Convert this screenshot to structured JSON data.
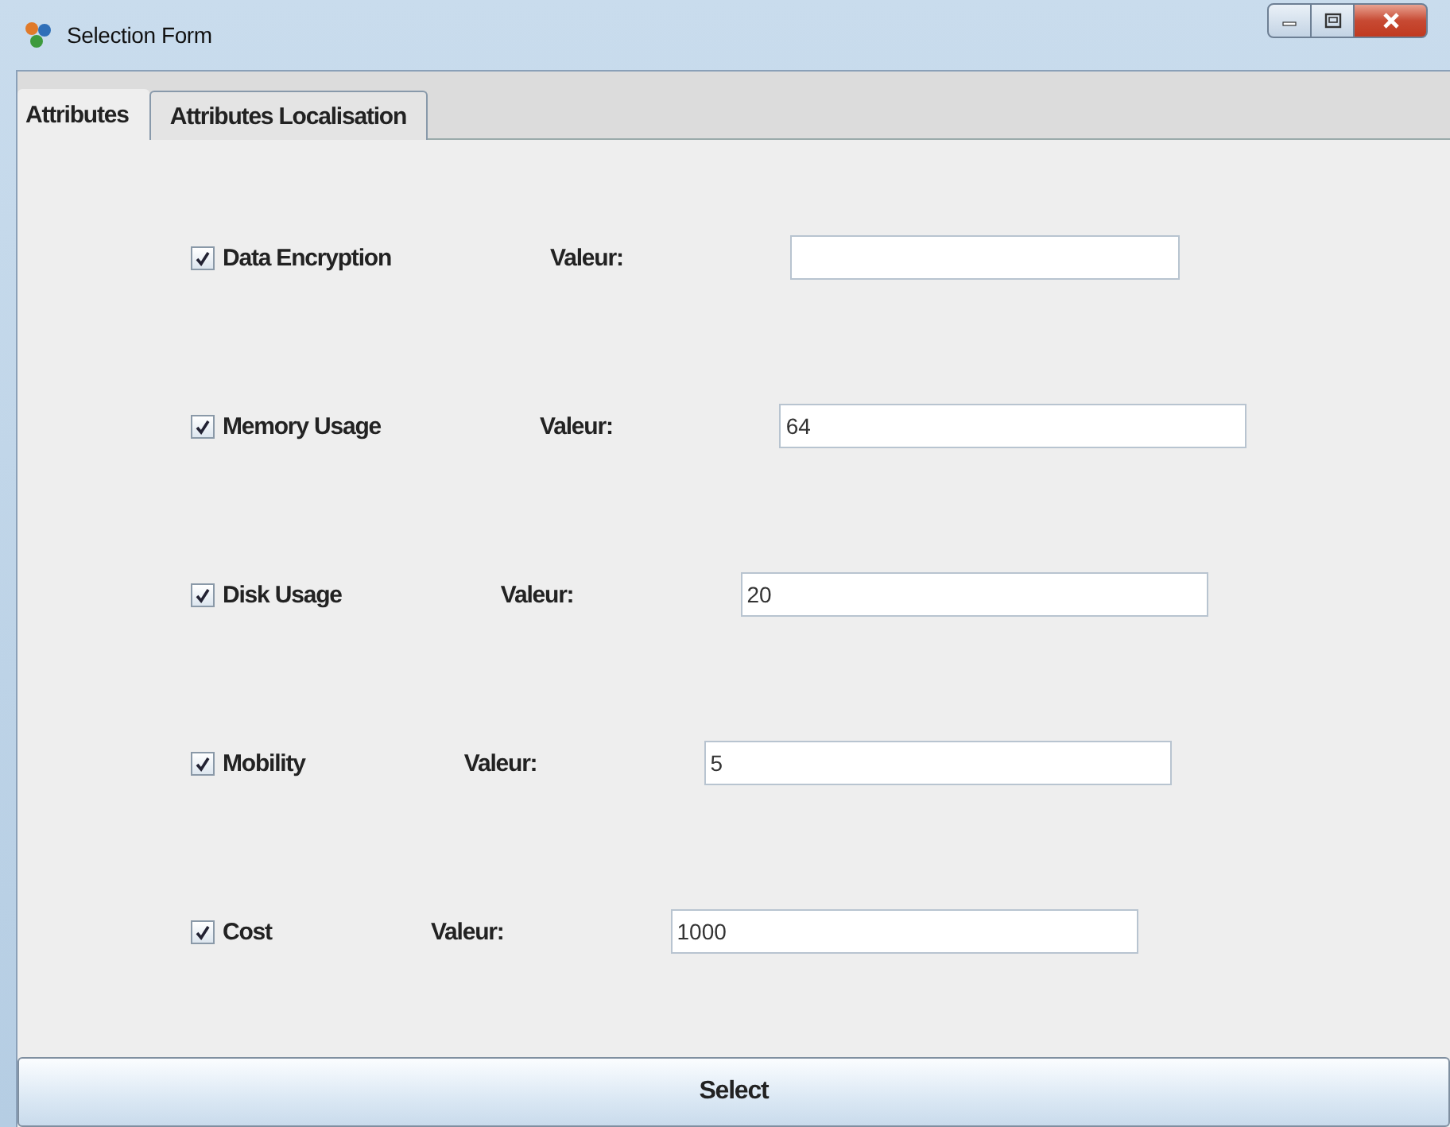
{
  "window": {
    "title": "Selection Form"
  },
  "tabs": [
    {
      "label": "Attributes",
      "selected": true
    },
    {
      "label": "Attributes Localisation",
      "selected": false
    }
  ],
  "attributes": [
    {
      "label": "Data Encryption",
      "checked": true,
      "field_label": "Valeur:"
    },
    {
      "label": "Memory Usage",
      "checked": true,
      "field_label": "Valeur:",
      "value": "64"
    },
    {
      "label": "Disk Usage",
      "checked": true,
      "field_label": "Valeur:",
      "value": "20"
    },
    {
      "label": "Mobility",
      "checked": true,
      "field_label": "Valeur:",
      "value": "5"
    },
    {
      "label": "Cost",
      "checked": true,
      "field_label": "Valeur:",
      "value": "1000"
    }
  ],
  "buttons": [
    {
      "label": "Select"
    }
  ]
}
